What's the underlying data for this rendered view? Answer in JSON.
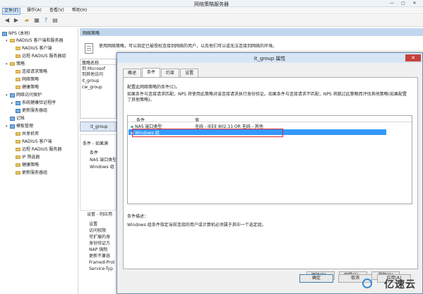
{
  "window": {
    "title": "网络策略服务器",
    "minimize": "—",
    "maximize": "▢",
    "close": "✕"
  },
  "menu": [
    "文件(F)",
    "操作(A)",
    "查看(V)",
    "帮助(H)"
  ],
  "tree": {
    "root": "NPS (本地)",
    "items": [
      {
        "label": "RADIUS 客户端和服务器",
        "level": 1,
        "expander": "▾"
      },
      {
        "label": "RADIUS 客户端",
        "level": 2
      },
      {
        "label": "远程 RADIUS 服务器组",
        "level": 2
      },
      {
        "label": "策略",
        "level": 1,
        "expander": "▾"
      },
      {
        "label": "连接请求策略",
        "level": 2
      },
      {
        "label": "网络策略",
        "level": 2
      },
      {
        "label": "健康策略",
        "level": 2
      },
      {
        "label": "网络访问保护",
        "level": 1,
        "expander": "▾"
      },
      {
        "label": "系统健康验证程序",
        "level": 2,
        "expander": "▸"
      },
      {
        "label": "更新服务器组",
        "level": 2
      },
      {
        "label": "记帐",
        "level": 1
      },
      {
        "label": "模板管理",
        "level": 1,
        "expander": "▾"
      },
      {
        "label": "共享机密",
        "level": 2
      },
      {
        "label": "RADIUS 客户端",
        "level": 2
      },
      {
        "label": "远程 RADIUS 服务器",
        "level": 2
      },
      {
        "label": "IP 筛选器",
        "level": 2
      },
      {
        "label": "健康策略",
        "level": 2
      },
      {
        "label": "更新服务器组",
        "level": 2
      }
    ]
  },
  "middle": {
    "header": "网络策略",
    "info": "使用网络策略，可以指定已被授权连接到网络的用户，以及他们可以或无法连接到网络的环境。",
    "list_header": "策略名称",
    "list_rows": [
      "到 Microsof",
      "到其他访问",
      "it_group",
      "cw_group"
    ],
    "selected_policy": "it_group",
    "conditions_label": "条件 - 如果满",
    "conditions_items": [
      "条件",
      "NAS 端口类型",
      "Windows 组"
    ],
    "settings_label": "设置 - 则应用",
    "settings_items": [
      "设置",
      "访问权限",
      "可扩展的身",
      "身份验证方",
      "NAP 强制",
      "更新不兼容",
      "Framed-Prot",
      "Service-Typ"
    ]
  },
  "dialog": {
    "title": "it_group 属性",
    "close": "✕",
    "tabs": [
      "概述",
      "条件",
      "约束",
      "设置"
    ],
    "active_tab": 1,
    "heading": "配置此网络策略的条件(C)。",
    "text": "如果条件与连接请求匹配，NPS 将使用此策略对该连接请求执行身份验证。如果条件与连接请求不匹配，NPS 将跳过此策略而评估其他策略(如果配置了其他策略)。",
    "columns": [
      "条件",
      "值"
    ],
    "rows": [
      {
        "name": "NAS 端口类型",
        "value": "无线 - IEEE 802.11 OR 无线 - 其他"
      },
      {
        "name": "Windows 组",
        "value": ""
      }
    ],
    "desc_label": "条件描述：",
    "desc": "Windows 组条件指定当前连接的用户或计算机必须属于其中一个选定组。",
    "buttons": {
      "add": "添加(D)...",
      "edit": "编辑(E)...",
      "remove": "删除(R)"
    },
    "footer": {
      "ok": "确定",
      "cancel": "取消",
      "apply": "应用(A)"
    }
  },
  "watermark": "亿速云"
}
